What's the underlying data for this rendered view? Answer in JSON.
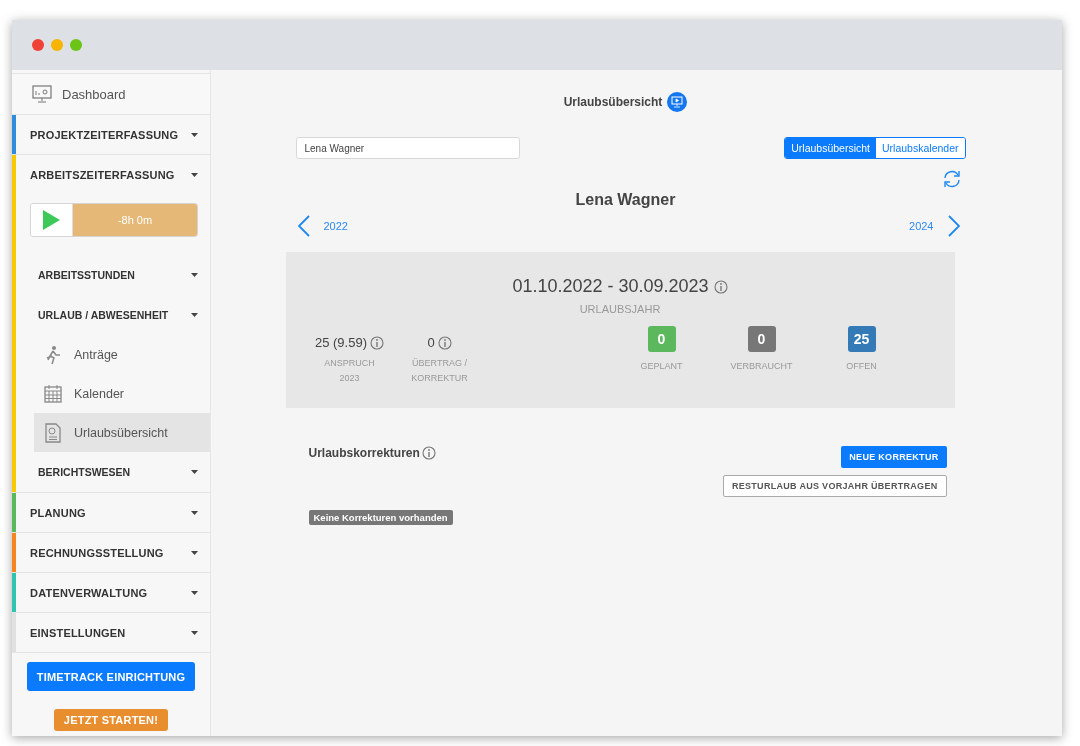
{
  "sidebar": {
    "items": [
      {
        "kind": "link",
        "label": "Dashboard"
      },
      {
        "kind": "section",
        "label": "PROJEKTZEITERFASSUNG",
        "color": "#2f8ddb"
      },
      {
        "kind": "section",
        "label": "ARBEITSZEITERFASSUNG",
        "color": "#f7c900",
        "timer": "-8h 0m",
        "children": [
          {
            "kind": "subsection",
            "label": "ARBEITSSTUNDEN"
          },
          {
            "kind": "subsection",
            "label": "URLAUB / ABWESENHEIT",
            "children": [
              {
                "label": "Anträge",
                "selected": false
              },
              {
                "label": "Kalender",
                "selected": false
              },
              {
                "label": "Urlaubsübersicht",
                "selected": true
              }
            ]
          },
          {
            "kind": "subsection",
            "label": "BERICHTSWESEN"
          }
        ]
      },
      {
        "kind": "section",
        "label": "PLANUNG",
        "color": "#5cb85c"
      },
      {
        "kind": "section",
        "label": "RECHNUNGSSTELLUNG",
        "color": "#f5861f"
      },
      {
        "kind": "section",
        "label": "DATENVERWALTUNG",
        "color": "#2ec4b0"
      },
      {
        "kind": "section",
        "label": "EINSTELLUNGEN",
        "color": "#e0e0e0"
      }
    ],
    "buttons": [
      {
        "kind": "primary",
        "label": "TIMETRACK EINRICHTUNG"
      },
      {
        "kind": "accent",
        "label": "JETZT STARTEN!"
      }
    ]
  },
  "main": {
    "title": "Urlaubsübersicht",
    "search": {
      "value": "Lena Wagner"
    },
    "tabs": [
      {
        "label": "Urlaubsübersicht",
        "selected": true
      },
      {
        "label": "Urlaubskalender",
        "selected": false
      }
    ],
    "person": "Lena Wagner",
    "prev_year": "2022",
    "next_year": "2024",
    "summary": {
      "period": "01.10.2022 - 30.09.2023",
      "period_label": "URLAUBSJAHR",
      "stats": [
        {
          "value": "25 (9.59)",
          "label": "ANSPRUCH",
          "sublabel": "2023"
        },
        {
          "value": "0",
          "label": "ÜBERTRAG / KORREKTUR"
        }
      ],
      "badges": [
        {
          "value": "0",
          "label": "GEPLANT",
          "color": "#5cb85c"
        },
        {
          "value": "0",
          "label": "VERBRAUCHT",
          "color": "#777777"
        },
        {
          "value": "25",
          "label": "OFFEN",
          "color": "#337ab7"
        }
      ]
    },
    "corrections": {
      "title": "Urlaubskorrekturen",
      "buttons": [
        {
          "kind": "primary",
          "label": "NEUE KORREKTUR"
        },
        {
          "kind": "outline",
          "label": "RESTURLAUB AUS VORJAHR ÜBERTRAGEN"
        }
      ],
      "empty": "Keine Korrekturen vorhanden"
    }
  }
}
